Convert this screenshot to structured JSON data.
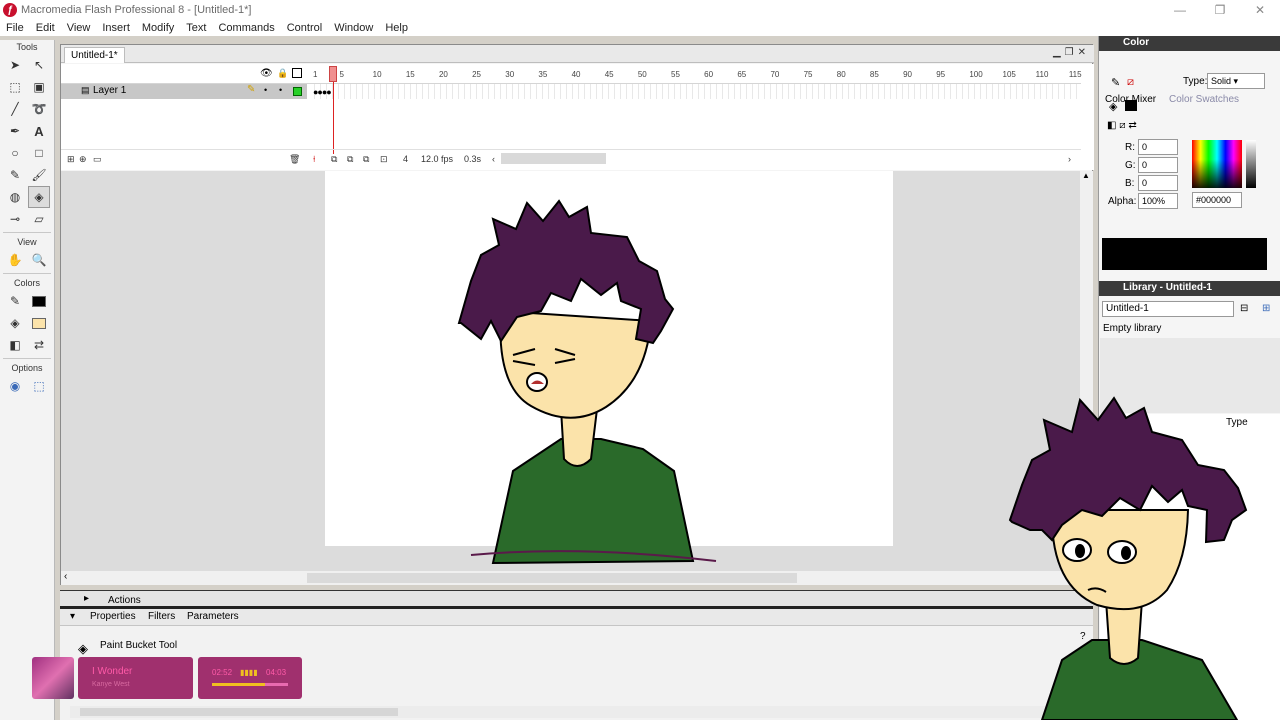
{
  "window": {
    "title": "Macromedia Flash Professional 8 - [Untitled-1*]",
    "app_icon": "flash-logo-icon",
    "controls": [
      "minimize-icon",
      "maximize-icon",
      "close-icon"
    ]
  },
  "menu": [
    "File",
    "Edit",
    "View",
    "Insert",
    "Modify",
    "Text",
    "Commands",
    "Control",
    "Window",
    "Help"
  ],
  "tools": {
    "title": "Tools",
    "view_title": "View",
    "colors_title": "Colors",
    "options_title": "Options",
    "selected_tool": "paint-bucket-tool"
  },
  "document": {
    "tab": "Untitled-1*",
    "layer_name": "Layer 1",
    "ruler": [
      "1",
      "5",
      "10",
      "15",
      "20",
      "25",
      "30",
      "35",
      "40",
      "45",
      "50",
      "55",
      "60",
      "65",
      "70",
      "75",
      "80",
      "85",
      "90",
      "95",
      "100",
      "105",
      "110",
      "115"
    ],
    "current_frame": "4",
    "frame_rate": "12.0 fps",
    "elapsed": "0.3s"
  },
  "actions": {
    "label": "Actions"
  },
  "properties": {
    "tabs": [
      "Properties",
      "Filters",
      "Parameters"
    ],
    "tool_name": "Paint Bucket Tool"
  },
  "music_overlay": {
    "song": "I Wonder",
    "artist": "Kanye West",
    "elapsed": "02:52",
    "total": "04:03",
    "progress": 0.7,
    "accent": "#a0306e"
  },
  "color_panel": {
    "title": "Color",
    "tabs": [
      "Color Mixer",
      "Color Swatches"
    ],
    "type_label": "Type:",
    "type_value": "Solid",
    "r_label": "R:",
    "r_value": "0",
    "g_label": "G:",
    "g_value": "0",
    "b_label": "B:",
    "b_value": "0",
    "alpha_label": "Alpha:",
    "alpha_value": "100%",
    "hex_value": "#000000",
    "preview_color": "#000000"
  },
  "library_panel": {
    "title": "Library - Untitled-1",
    "selected": "Untitled-1",
    "status": "Empty library",
    "column_type": "Type"
  },
  "drawing": {
    "hair_color": "#4a1a4a",
    "skin_color": "#fbe3aa",
    "shirt_color": "#2a6a2a"
  }
}
